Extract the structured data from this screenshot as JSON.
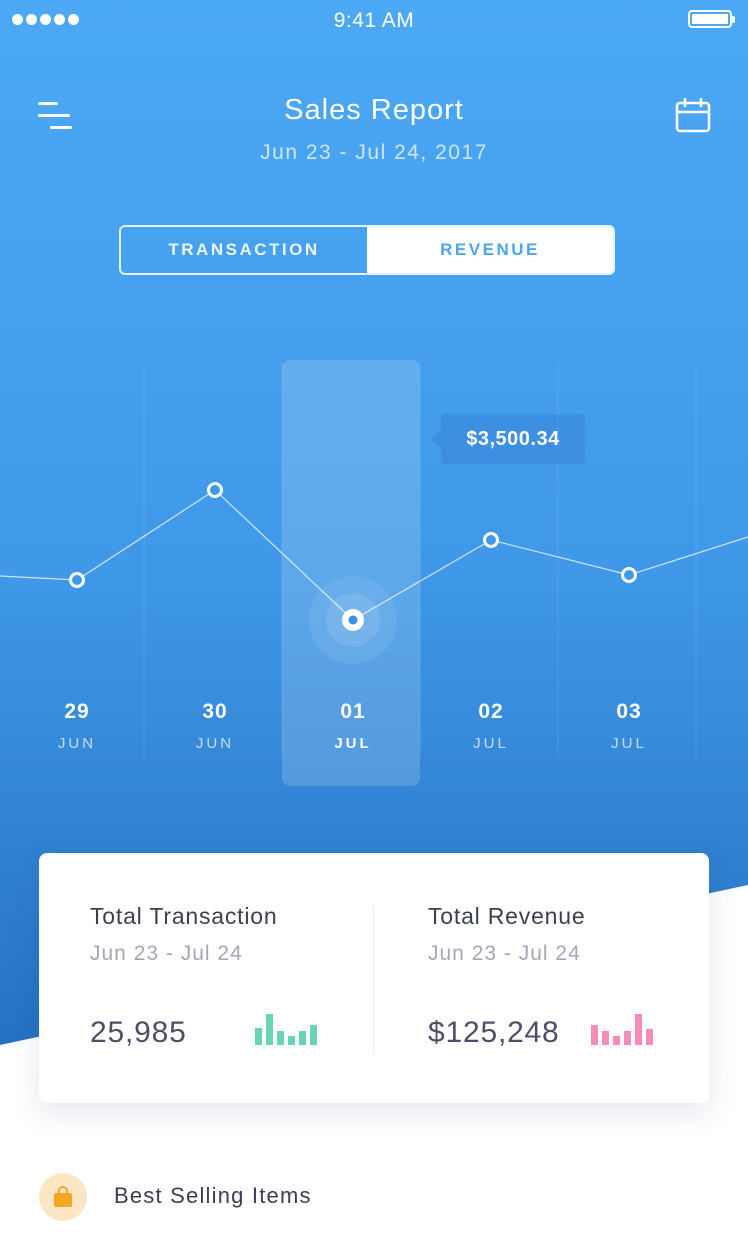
{
  "status_bar": {
    "time": "9:41 AM"
  },
  "header": {
    "title": "Sales Report",
    "date_range": "Jun 23 - Jul 24, 2017",
    "menu_icon": "menu-icon",
    "calendar_icon": "calendar-icon"
  },
  "toggle": {
    "options": [
      {
        "label": "TRANSACTION",
        "selected": false
      },
      {
        "label": "REVENUE",
        "selected": true
      }
    ]
  },
  "chart_data": {
    "type": "line",
    "x": [
      {
        "day": "29",
        "month": "JUN"
      },
      {
        "day": "30",
        "month": "JUN"
      },
      {
        "day": "01",
        "month": "JUL"
      },
      {
        "day": "02",
        "month": "JUL"
      },
      {
        "day": "03",
        "month": "JUL"
      }
    ],
    "values": [
      3900,
      4800,
      3500,
      4300,
      3950
    ],
    "selected_index": 2,
    "tooltip": "$3,500.34",
    "grid": true
  },
  "summary": {
    "transaction": {
      "title": "Total Transaction",
      "range": "Jun 23 - Jul 24",
      "value": "25,985",
      "spark": [
        0.55,
        1.0,
        0.45,
        0.3,
        0.45,
        0.65
      ],
      "color": "#67d4b6"
    },
    "revenue": {
      "title": "Total Revenue",
      "range": "Jun 23 - Jul 24",
      "value": "$125,248",
      "spark": [
        0.65,
        0.45,
        0.3,
        0.45,
        1.0,
        0.5
      ],
      "color": "#f78cba"
    }
  },
  "best_selling": {
    "label": "Best Selling Items",
    "icon": "shopping-bag-icon"
  },
  "colors": {
    "gradient_top": "#4ca9f5",
    "gradient_bottom": "#2a78c9",
    "accent": "#4da5ef"
  }
}
